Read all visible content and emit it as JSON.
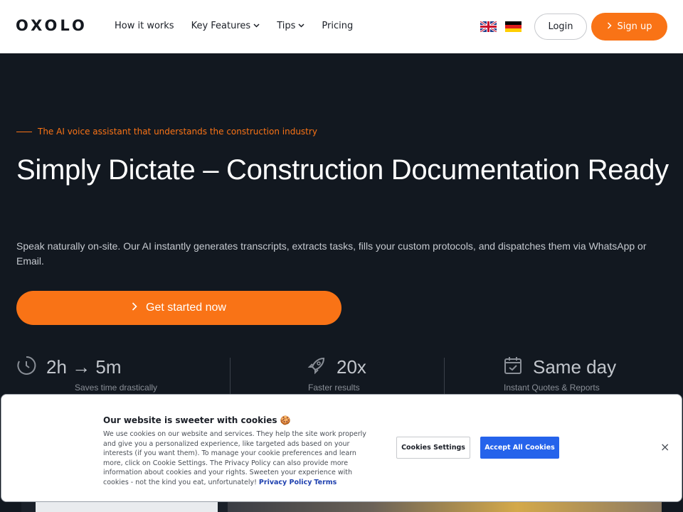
{
  "header": {
    "logo": "OXOLO",
    "nav": [
      {
        "label": "How it works",
        "dropdown": false
      },
      {
        "label": "Key Features",
        "dropdown": true
      },
      {
        "label": "Tips",
        "dropdown": true
      },
      {
        "label": "Pricing",
        "dropdown": false
      }
    ],
    "login_label": "Login",
    "signup_label": "Sign up"
  },
  "hero": {
    "eyebrow": "The AI voice assistant that understands the construction industry",
    "title": "Simply Dictate – Construction Documentation Ready",
    "subtitle": "Speak naturally on-site. Our AI instantly generates transcripts, extracts tasks, fills your custom protocols, and dispatches them via WhatsApp or Email.",
    "cta_label": "Get started now"
  },
  "stats": [
    {
      "icon": "clock-icon",
      "value": "2h → 5m",
      "label": "Saves time drastically"
    },
    {
      "icon": "rocket-icon",
      "value": "20x",
      "label": "Faster results"
    },
    {
      "icon": "calendar-check-icon",
      "value": "Same day",
      "label": "Instant Quotes & Reports"
    }
  ],
  "cookie": {
    "title": "Our website is sweeter with cookies 🍪",
    "body": "We use cookies on our website and services. They help the site work properly and give you a personalized experience, like targeted ads based on your interests (if you want them). To manage your cookie preferences and learn more, click on Cookie Settings. The Privacy Policy can also provide more information about cookies and your rights. Sweeten your experience with cookies - not the kind you eat, unfortunately!",
    "privacy_link": "Privacy Policy",
    "terms_link": "Terms",
    "settings_label": "Cookies Settings",
    "accept_label": "Accept All Cookies",
    "close_label": "×"
  },
  "colors": {
    "accent": "#f97316",
    "background": "#121820",
    "accept_button": "#2563eb"
  }
}
